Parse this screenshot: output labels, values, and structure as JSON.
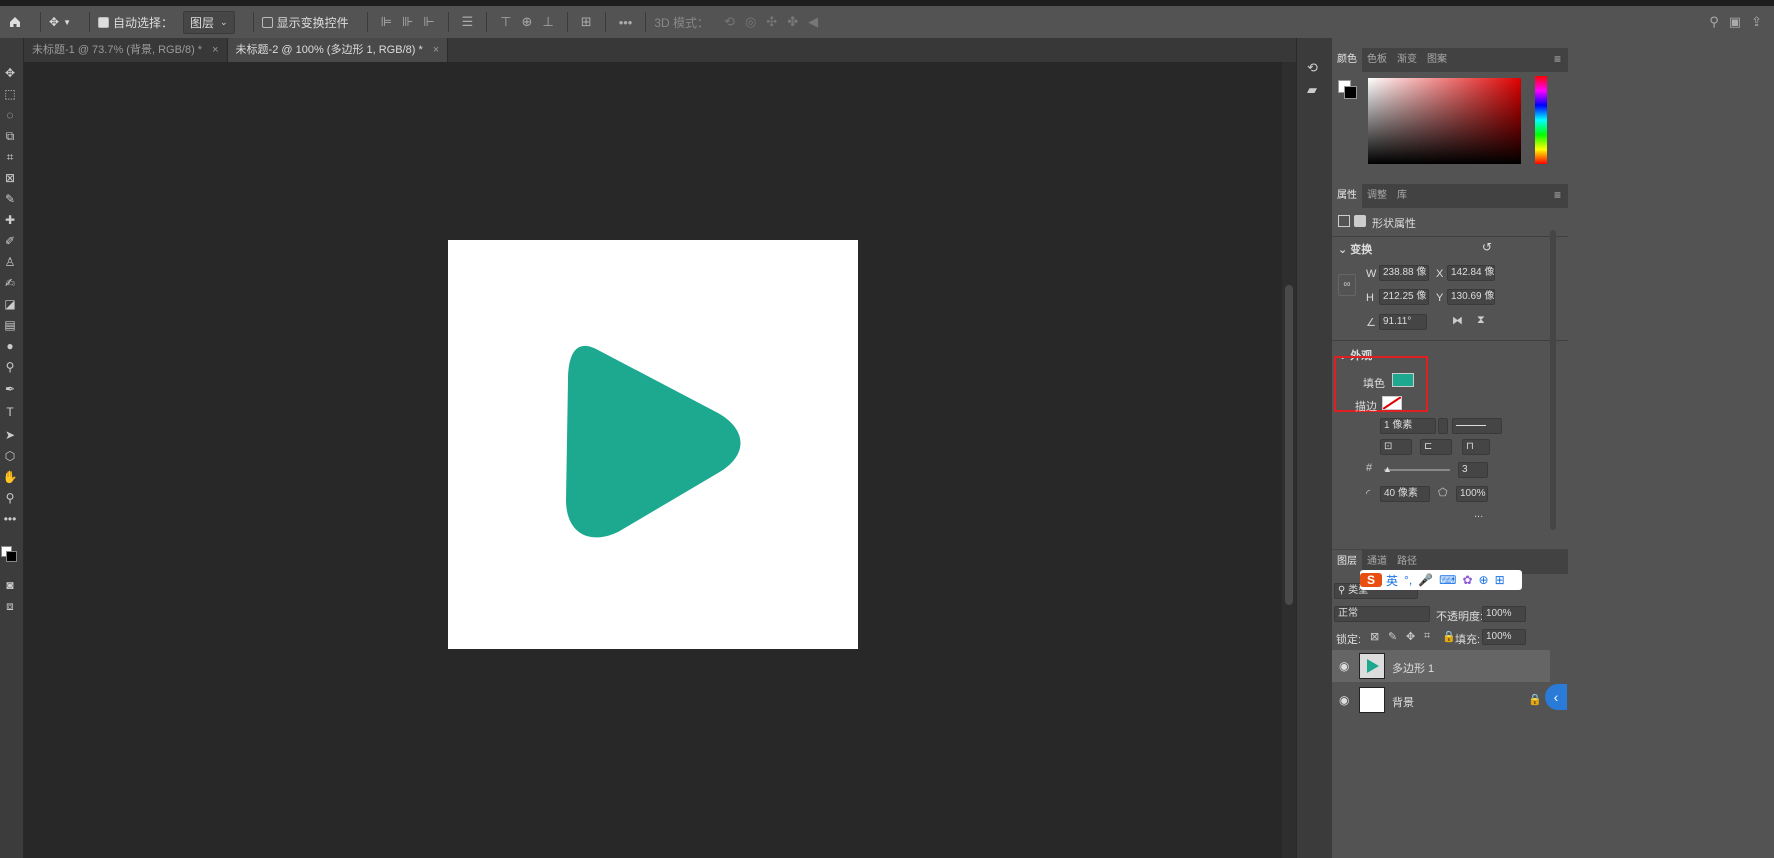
{
  "options_bar": {
    "auto_select_label": "自动选择：",
    "auto_select_value": "图层",
    "show_transform_label": "显示变换控件",
    "mode_3d_label": "3D 模式："
  },
  "tabs": [
    {
      "label": "未标题-1 @ 73.7% (背景, RGB/8) *",
      "close": "×"
    },
    {
      "label": "未标题-2 @ 100% (多边形 1, RGB/8) *",
      "close": "×"
    }
  ],
  "color_panel": {
    "tabs": [
      "颜色",
      "色板",
      "渐变",
      "图案"
    ]
  },
  "properties_panel": {
    "tabs": [
      "属性",
      "调整",
      "库"
    ],
    "header": "形状属性",
    "transform_title": "变换",
    "w_label": "W",
    "w_value": "238.88 像",
    "x_label": "X",
    "x_value": "142.84 像",
    "h_label": "H",
    "h_value": "212.25 像",
    "y_label": "Y",
    "y_value": "130.69 像",
    "angle_value": "91.11°",
    "appearance_title": "外观",
    "fill_label": "填色",
    "fill_color": "#1ca98f",
    "stroke_label": "描边",
    "stroke_width": "1 像素",
    "sides_value": "3",
    "corner_radius": "40 像素",
    "star_ratio": "100%",
    "more": "..."
  },
  "layers_panel": {
    "tabs": [
      "图层",
      "通道",
      "路径"
    ],
    "filter_label": "类型",
    "blend_mode": "正常",
    "opacity_label": "不透明度:",
    "opacity_value": "100%",
    "lock_label": "锁定:",
    "fill_label": "填充:",
    "fill_value": "100%",
    "layers": [
      {
        "name": "多边形 1"
      },
      {
        "name": "背景"
      }
    ]
  },
  "ime_bar": {
    "brand": "S",
    "lang": "英"
  },
  "colors": {
    "accent_teal": "#1ca98f",
    "highlight_red": "#e02020"
  }
}
